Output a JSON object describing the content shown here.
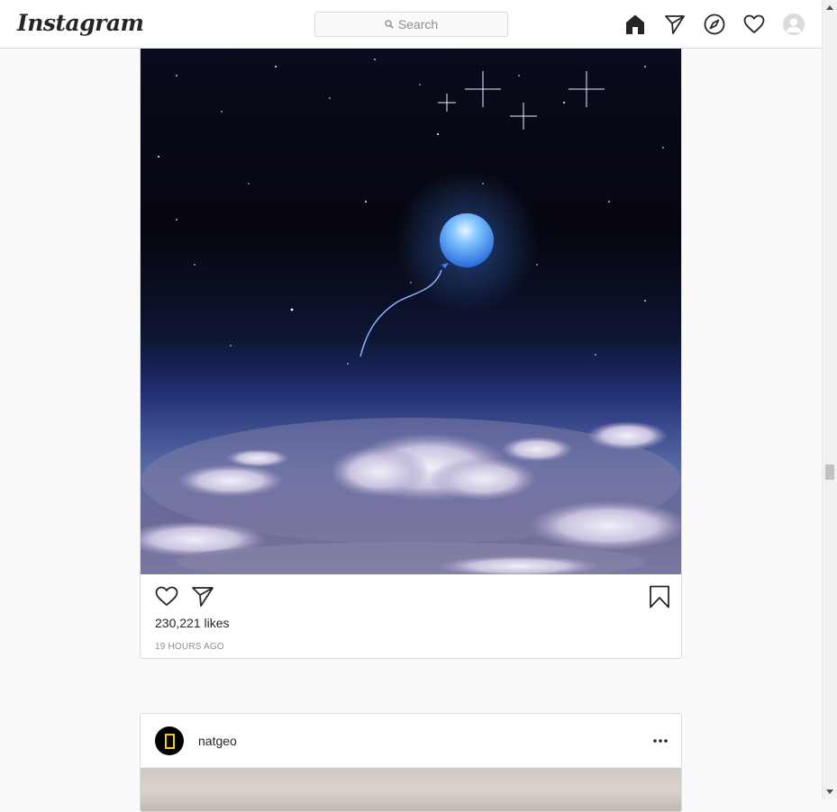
{
  "header": {
    "logo": "Instagram",
    "search_placeholder": "Search",
    "icons": [
      "home-icon",
      "direct-icon",
      "explore-icon",
      "activity-heart-icon",
      "profile-avatar"
    ]
  },
  "feed": {
    "post1": {
      "image_alt": "Glowing blue balloon floating in a starry night sky above clouds",
      "likes": "230,221 likes",
      "time_ago": "19 HOURS AGO"
    },
    "post2": {
      "username": "natgeo",
      "more_label": "..."
    }
  },
  "colors": {
    "text": "#262626",
    "muted": "#8e8e8e",
    "border": "#dbdbdb",
    "background": "#fafafa",
    "natgeo_yellow": "#ffce00"
  }
}
